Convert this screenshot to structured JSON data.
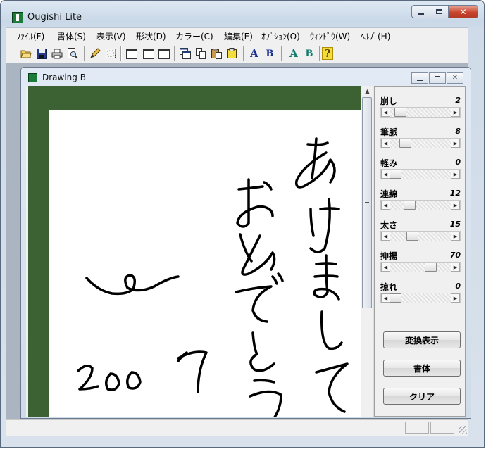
{
  "window": {
    "title": "Ougishi Lite",
    "icon": "ougishi-app-icon",
    "controls": [
      "minimize-icon",
      "maximize-icon",
      "close-icon"
    ]
  },
  "menu": [
    {
      "label": "ﾌｧｲﾙ(F)"
    },
    {
      "label": "書体(S)"
    },
    {
      "label": "表示(V)"
    },
    {
      "label": "形状(D)"
    },
    {
      "label": "カラー(C)"
    },
    {
      "label": "編集(E)"
    },
    {
      "label": "ｵﾌﾟｼｮﾝ(O)"
    },
    {
      "label": "ｳｨﾝﾄﾞｳ(W)"
    },
    {
      "label": "ﾍﾙﾌﾟ(H)"
    }
  ],
  "toolbar": {
    "text_a_label": "A",
    "text_b_label": "B",
    "color_a_label": "A",
    "color_b_label": "B",
    "help_label": "?",
    "colors": {
      "navy": "#1b2f8f",
      "teal": "#107a6c",
      "yellow": "#f3dc3c"
    }
  },
  "child_window": {
    "title": "Drawing B"
  },
  "canvas": {
    "background": "#3c6133",
    "paper": "#ffffff",
    "ink": "#000000"
  },
  "params": [
    {
      "label": "崩し",
      "value": "2",
      "level": 0.1
    },
    {
      "label": "筆脈",
      "value": "8",
      "level": 0.2
    },
    {
      "label": "軽み",
      "value": "0",
      "level": 0.0
    },
    {
      "label": "連綿",
      "value": "12",
      "level": 0.28
    },
    {
      "label": "太さ",
      "value": "15",
      "level": 0.33
    },
    {
      "label": "抑揚",
      "value": "70",
      "level": 0.7
    },
    {
      "label": "掠れ",
      "value": "0",
      "level": 0.0
    }
  ],
  "buttons": {
    "convert": "変換表示",
    "font": "書体",
    "clear": "クリア"
  }
}
